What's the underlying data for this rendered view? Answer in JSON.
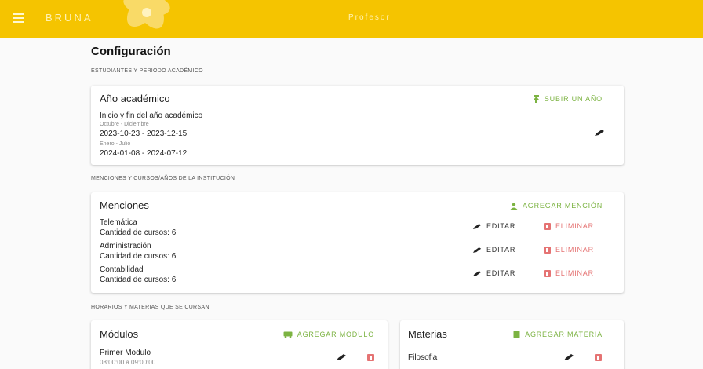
{
  "header": {
    "brand": "BRUNA",
    "role": "Profesor"
  },
  "page": {
    "title": "Configuración"
  },
  "sections": {
    "students": "ESTUDIANTES Y PERIODO ACADÉMICO",
    "mentions": "MENCIONES Y CURSOS/AÑOS DE LA INSTITUCIÓN",
    "schedule": "HORARIOS Y MATERIAS QUE SE CURSAN"
  },
  "academic_year": {
    "title": "Año académico",
    "action": "SUBIR UN AÑO",
    "subtitle": "Inicio y fin del año académico",
    "periods": [
      {
        "name": "Octubre - Diciembre",
        "range": "2023-10-23 - 2023-12-15"
      },
      {
        "name": "Enero - Julio",
        "range": "2024-01-08 - 2024-07-12"
      }
    ]
  },
  "mentions": {
    "title": "Menciones",
    "action": "AGREGAR MENCIÓN",
    "edit_label": "EDITAR",
    "delete_label": "ELIMINAR",
    "items": [
      {
        "name": "Telemática",
        "courses": "Cantidad de cursos: 6"
      },
      {
        "name": "Administración",
        "courses": "Cantidad de cursos: 6"
      },
      {
        "name": "Contabilidad",
        "courses": "Cantidad de cursos: 6"
      }
    ]
  },
  "modules": {
    "title": "Módulos",
    "action": "AGREGAR MODULO",
    "items": [
      {
        "name": "Primer Modulo",
        "time": "08:00:00 a 09:00:00"
      }
    ]
  },
  "subjects": {
    "title": "Materias",
    "action": "AGREGAR MATERIA",
    "items": [
      {
        "name": "Filosofia"
      }
    ]
  },
  "colors": {
    "topbar": "#f5c400",
    "accent_green": "#7cb342",
    "danger": "#e57373"
  }
}
